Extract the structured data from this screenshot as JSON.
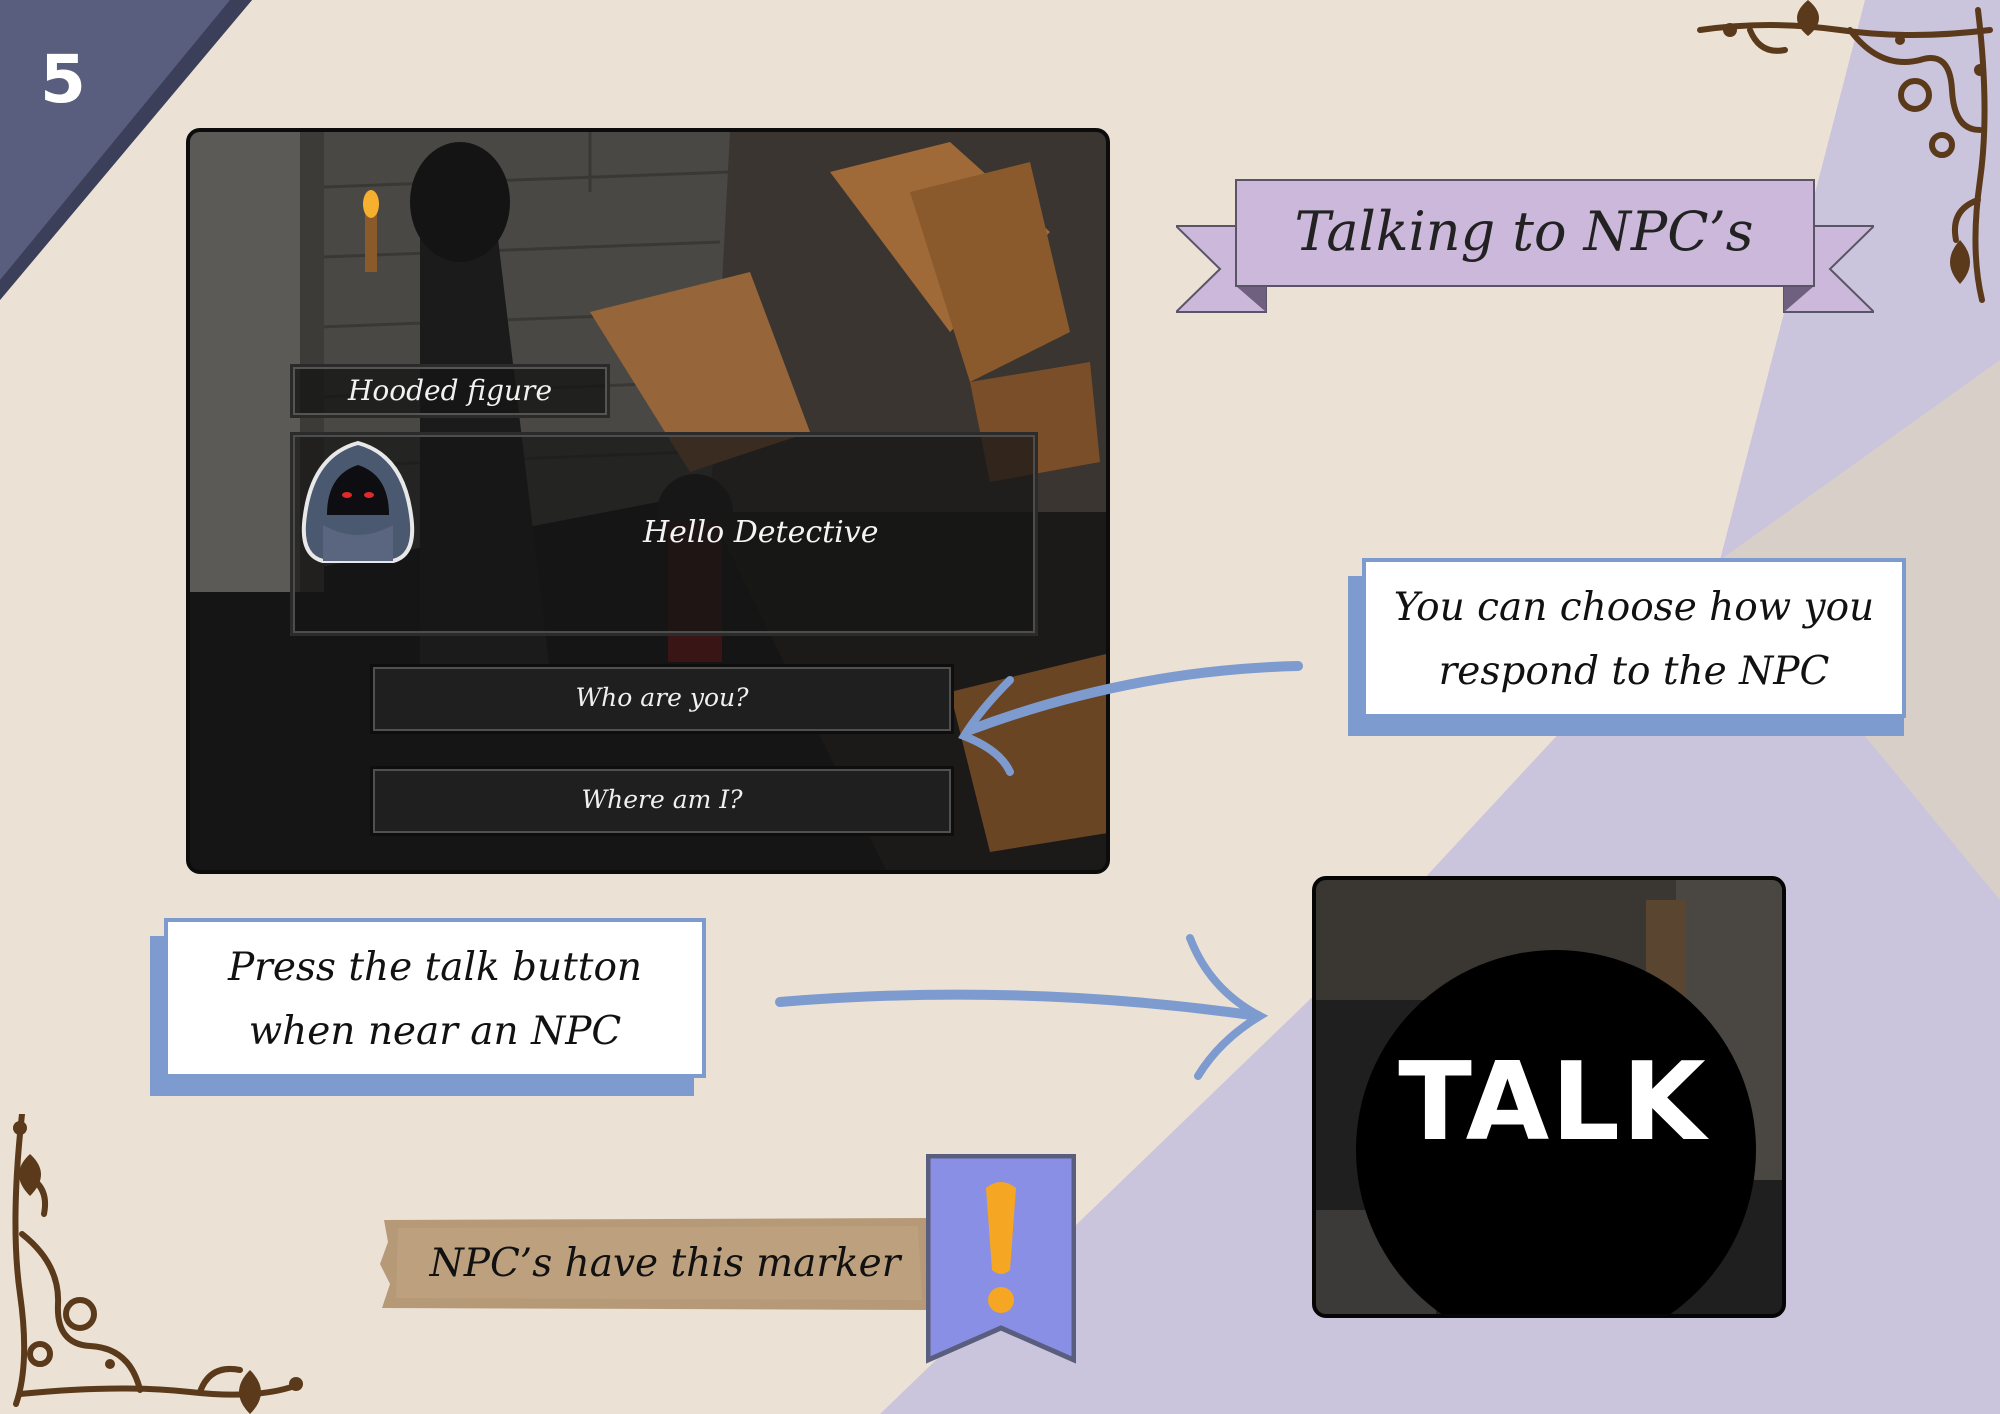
{
  "page": {
    "number": "5",
    "title": "Talking to NPC’s"
  },
  "colors": {
    "background": "#ebe2d5",
    "lavender": "#cbc4dd",
    "slate_corner": "#5a5e7e",
    "accent_blue": "#7e9bd0",
    "banner_purple": "#cbb8db",
    "ornament_brown": "#5a3a1a",
    "marker_blue": "#8a8fe6",
    "marker_orange": "#f5a623"
  },
  "game_screenshot": {
    "npc_name": "Hooded figure",
    "dialogue": "Hello Detective",
    "choices": [
      "Who are you?",
      "Where am I?"
    ]
  },
  "callouts": {
    "respond": [
      "You can choose how you",
      "respond to the NPC"
    ],
    "talk_button": [
      "Press the talk button",
      "when near an NPC"
    ]
  },
  "talk_button_image": {
    "label": "TALK"
  },
  "marker_note": {
    "text": "NPC’s have this marker",
    "icon": "exclamation-icon"
  }
}
